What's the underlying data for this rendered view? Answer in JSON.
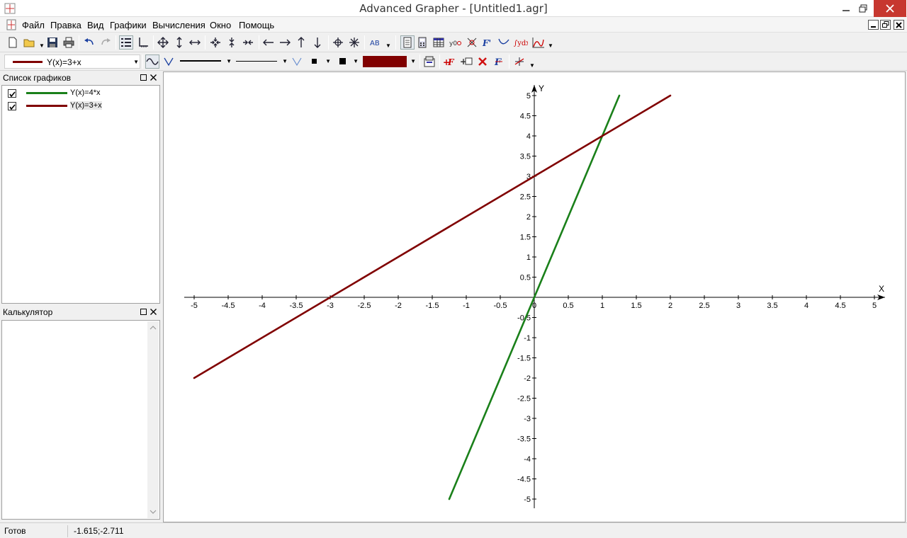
{
  "window": {
    "title": "Advanced Grapher - [Untitled1.agr]"
  },
  "menu": [
    "Файл",
    "Правка",
    "Вид",
    "Графики",
    "Вычисления",
    "Окно",
    "Помощь"
  ],
  "toolbar2": {
    "graph_select_value": "Y(x)=3+x",
    "color_swatch": "#800000"
  },
  "graph_list": {
    "title": "Список графиков",
    "items": [
      {
        "label": "Y(x)=4*x",
        "checked": true,
        "color": "#1a801a"
      },
      {
        "label": "Y(x)=3+x",
        "checked": true,
        "color": "#800000"
      }
    ]
  },
  "calculator": {
    "title": "Калькулятор"
  },
  "chart_data": {
    "type": "line",
    "xlabel": "X",
    "ylabel": "Y",
    "xlim": [
      -5,
      5
    ],
    "ylim": [
      -5,
      5
    ],
    "x_ticks": [
      "-5",
      "-4.5",
      "-4",
      "-3.5",
      "-3",
      "-2.5",
      "-2",
      "-1.5",
      "-1",
      "-0.5",
      "0",
      "0.5",
      "1",
      "1.5",
      "2",
      "2.5",
      "3",
      "3.5",
      "4",
      "4.5",
      "5"
    ],
    "y_ticks": [
      "5",
      "4.5",
      "4",
      "3.5",
      "3",
      "2.5",
      "2",
      "1.5",
      "1",
      "0.5",
      "-0.5",
      "-1",
      "-1.5",
      "-2",
      "-2.5",
      "-3",
      "-3.5",
      "-4",
      "-4.5",
      "-5"
    ],
    "series": [
      {
        "name": "Y(x)=4*x",
        "color": "#1a801a",
        "x": [
          -1.25,
          1.25
        ],
        "y": [
          -5,
          5
        ]
      },
      {
        "name": "Y(x)=3+x",
        "color": "#800000",
        "x": [
          -5,
          2
        ],
        "y": [
          -2,
          5
        ]
      }
    ]
  },
  "status": {
    "state": "Готов",
    "coords": "-1.615;-2.711"
  }
}
